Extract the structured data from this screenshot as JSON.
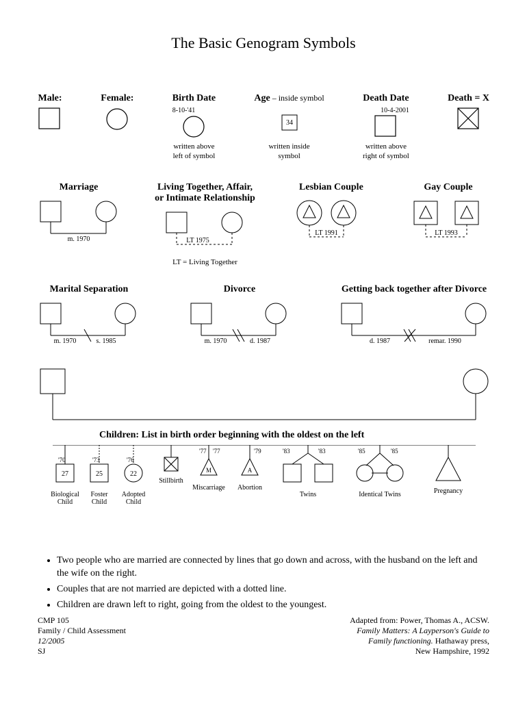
{
  "title": "The Basic Genogram Symbols",
  "row1": {
    "male": "Male:",
    "female": "Female:",
    "birthdate": "Birth Date",
    "birthdate_val": "8-10-'41",
    "birthdate_sub": "written above\nleft of symbol",
    "age": "Age",
    "age_dash": " – inside symbol",
    "age_val": "34",
    "age_sub": "written inside\nsymbol",
    "deathdate": "Death Date",
    "deathdate_val": "10-4-2001",
    "deathdate_sub": "written above\nright of symbol",
    "death": "Death = X"
  },
  "row2": {
    "marriage": "Marriage",
    "marriage_val": "m. 1970",
    "living": "Living Together, Affair,\nor Intimate Relationship",
    "living_val": "LT 1975",
    "living_note": "LT = Living Together",
    "lesbian": "Lesbian Couple",
    "lesbian_val": "LT 1991",
    "gay": "Gay Couple",
    "gay_val": "LT 1993"
  },
  "row3": {
    "sep": "Marital Separation",
    "sep_val1": "m. 1970",
    "sep_val2": "s. 1985",
    "div": "Divorce",
    "div_val1": "m. 1970",
    "div_val2": "d. 1987",
    "back": "Getting back together after Divorce",
    "back_val1": "d. 1987",
    "back_val2": "remar. 1990"
  },
  "children": {
    "header": "Children:  List in birth order beginning with the oldest on the left",
    "bio": {
      "year": "'70",
      "age": "27",
      "label": "Biological\nChild"
    },
    "foster": {
      "year": "'73",
      "age": "25",
      "label": "Foster\nChild"
    },
    "adopted": {
      "year": "'76",
      "age": "22",
      "label": "Adopted\nChild"
    },
    "stillbirth": {
      "label": "Stillbirth"
    },
    "misc": {
      "y1": "'77",
      "y2": "'77",
      "letter": "M",
      "label": "Miscarriage"
    },
    "abort": {
      "y": "'79",
      "letter": "A",
      "label": "Abortion"
    },
    "twins": {
      "y1": "'83",
      "y2": "'83",
      "label": "Twins"
    },
    "ident": {
      "y1": "'85",
      "y2": "'85",
      "label": "Identical Twins"
    },
    "preg": {
      "label": "Pregnancy"
    }
  },
  "bullets": [
    "Two people who are married are connected by lines that go down and across, with the husband on the left and the wife on the right.",
    "Couples that are not married are depicted with a dotted line.",
    "Children are drawn left to right, going from the oldest to the youngest."
  ],
  "footer": {
    "l1": "CMP 105",
    "l2": "Family / Child Assessment",
    "l3": "12/2005",
    "l4": "SJ",
    "r1a": "Adapted from:  Power, Thomas A., ACSW.",
    "r2": "Family Matters:  A Layperson's Guide to",
    "r3a": "Family functioning.",
    "r3b": "  Hathaway press,",
    "r4": "New Hampshire, 1992"
  }
}
